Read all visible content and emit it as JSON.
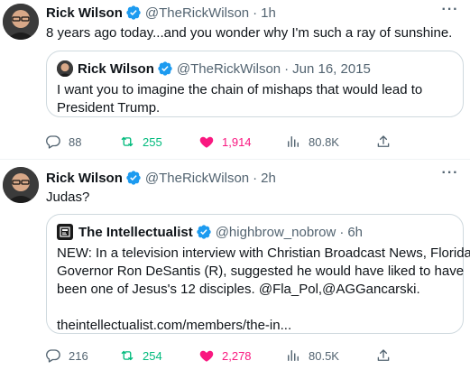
{
  "colors": {
    "text": "#0f1419",
    "secondary": "#536471",
    "verified": "#1d9bf0",
    "repost": "#00ba7c",
    "like": "#f91880",
    "border": "#cfd9de"
  },
  "tweets": [
    {
      "author": {
        "name": "Rick Wilson",
        "handle": "@TheRickWilson",
        "time": "1h",
        "separator": "·"
      },
      "text": "8 years ago today...and you wonder why I'm such a ray of sunshine.",
      "quote": {
        "author": {
          "name": "Rick Wilson",
          "handle": "@TheRickWilson",
          "time": "Jun 16, 2015",
          "separator": "·"
        },
        "lines": [
          "I want you to imagine the chain of mishaps that would lead to",
          "President Trump."
        ]
      },
      "stats": {
        "replies": "88",
        "reposts": "255",
        "likes": "1,914",
        "views": "80.8K"
      }
    },
    {
      "author": {
        "name": "Rick Wilson",
        "handle": "@TheRickWilson",
        "time": "2h",
        "separator": "·"
      },
      "text": "Judas?",
      "quote": {
        "author": {
          "name": "The Intellectualist",
          "handle": "@highbrow_nobrow",
          "time": "6h",
          "separator": "·"
        },
        "lines": [
          "NEW: In a television interview with Christian Broadcast News, Florida",
          "Governor Ron DeSantis (R), suggested he would have liked to have",
          "been one of Jesus's 12 disciples. @Fla_Pol,@AGGancarski.",
          "",
          "theintellectualist.com/members/the-in..."
        ]
      },
      "stats": {
        "replies": "216",
        "reposts": "254",
        "likes": "2,278",
        "views": "80.5K"
      }
    }
  ],
  "icons": [
    "verified-badge-icon",
    "more-icon",
    "reply-icon",
    "repost-icon",
    "like-icon",
    "views-icon",
    "share-icon"
  ]
}
